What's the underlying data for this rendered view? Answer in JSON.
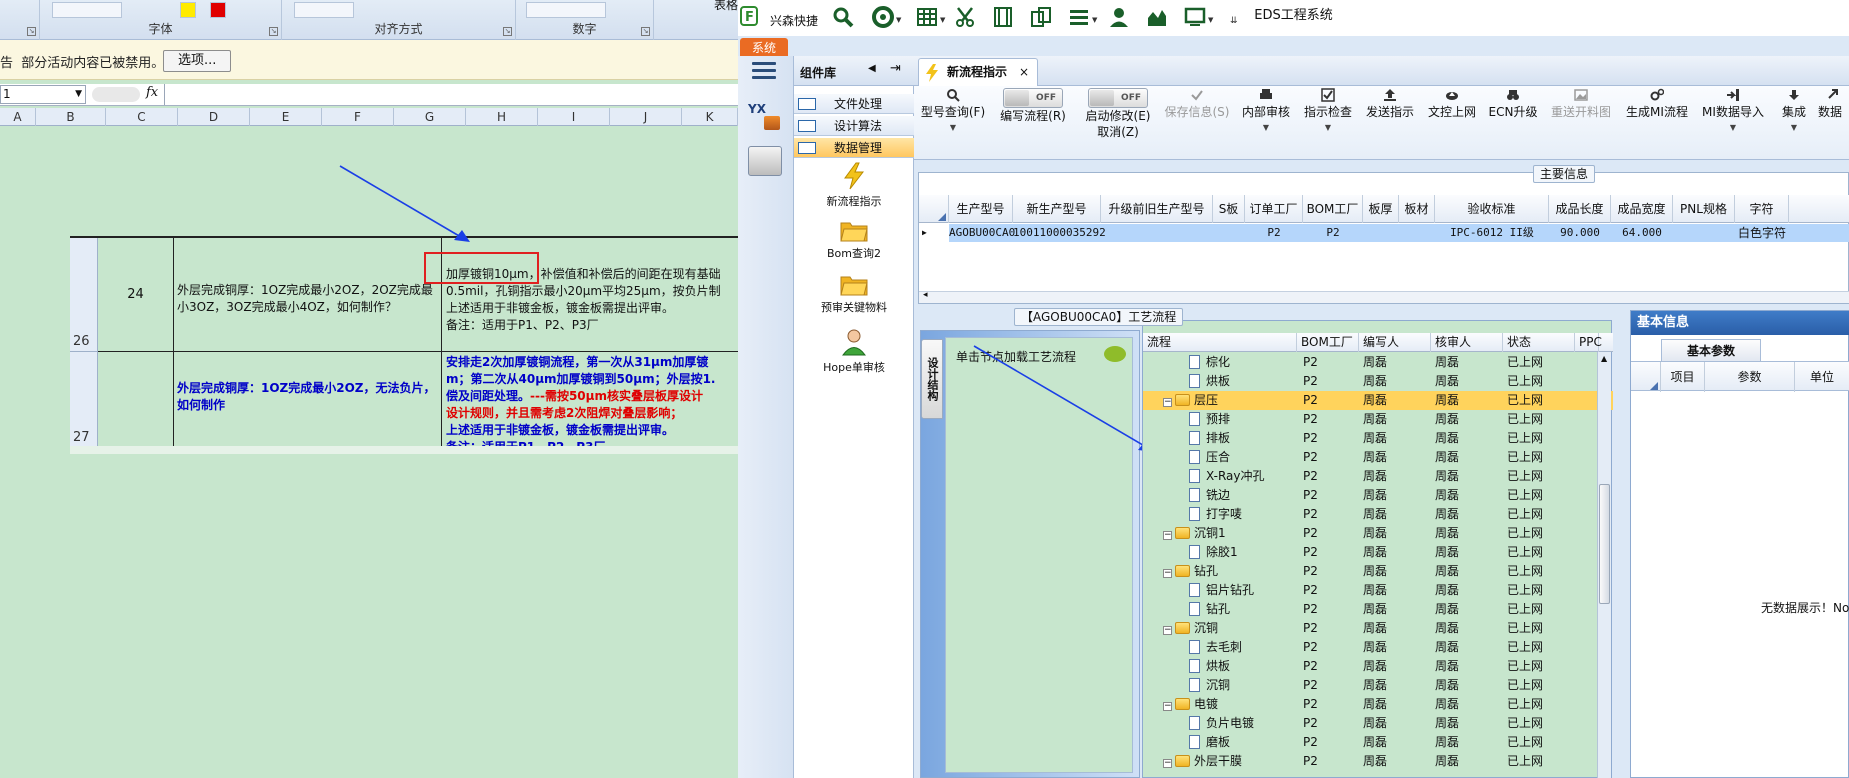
{
  "excel": {
    "ribbon_groups": [
      "字体",
      "对齐方式",
      "数字"
    ],
    "ribbon_partial": "表格",
    "security": {
      "prefix": "告",
      "message": "部分活动内容已被禁用。",
      "options_button": "选项..."
    },
    "namebox": "1",
    "fx": "fx",
    "columns": [
      "A",
      "B",
      "C",
      "D",
      "E",
      "F",
      "G",
      "H",
      "I",
      "J",
      "K"
    ],
    "rows": [
      {
        "number": "26",
        "index": "24",
        "question": "外层完成铜厚：1OZ完成最小2OZ，2OZ完成最小3OZ，3OZ完成最小4OZ，如何制作？",
        "answer": [
          "加厚镀铜10μm，补偿值和补偿后的间距在现有基础",
          "0.5mil，孔铜指示最小20μm平均25μm，按负片制",
          "上述适用于非镀金板，镀金板需提出评审。",
          "备注：适用于P1、P2、P3厂"
        ]
      },
      {
        "number": "27",
        "index": "",
        "question": "外层完成铜厚：1OZ完成最小2OZ，无法负片，如何制作",
        "answer_blue_1": "安排走2次加厚镀铜流程，第一次从31μm加厚镀",
        "answer_blue_2": "m；第二次从40μm加厚镀铜到50μm；外层按1.",
        "answer_mix_blue": "偿及间距处理。",
        "answer_mix_red": "---需按50μm核实叠层板厚设计",
        "answer_red_2": "设计规则，并且需考虑2次阻焊对叠层影响；",
        "answer_blue_3": "上述适用于非镀金板，镀金板需提出评审。",
        "answer_blue_4": "备注：适用于P1、P2、P3厂"
      }
    ]
  },
  "eds": {
    "window_title": "EDS工程系统",
    "brand": "兴森快捷",
    "system_tab": "系统",
    "library": {
      "title": "组件库",
      "categories": [
        "文件处理",
        "设计算法",
        "数据管理"
      ],
      "tools": [
        "新流程指示",
        "Bom查询2",
        "预审关键物料",
        "Hope单审核"
      ]
    },
    "doc_tab": "新流程指示",
    "doc_tab_close": "×",
    "toolbar": {
      "query": "型号查询(F)",
      "write_flow": "编写流程(R)",
      "enable_edit": "启动修改(E)",
      "cancel": "取消(Z)",
      "toggle_off": "OFF",
      "save_info": "保存信息(S)",
      "internal_review": "内部审核",
      "indicator_check": "指示检查",
      "send_indicator": "发送指示",
      "upload": "文控上网",
      "ecn_upgrade": "ECN升级",
      "resend_material": "重送开料图",
      "gen_mi_flow": "生成MI流程",
      "mi_import": "MI数据导入",
      "integrate": "集成",
      "data_partial": "数据"
    },
    "main_info": {
      "title": "主要信息",
      "columns": [
        "生产型号",
        "新生产型号",
        "升级前旧生产型号",
        "S板",
        "订单工厂",
        "BOM工厂",
        "板厚",
        "板材",
        "验收标准",
        "成品长度",
        "成品宽度",
        "PNL规格",
        "字符"
      ],
      "row": [
        "AGOBU00CA0",
        "10011000035292",
        "",
        "",
        "P2",
        "P2",
        "",
        "",
        "IPC-6012 II级",
        "90.000",
        "64.000",
        "",
        "白色字符"
      ]
    },
    "structure": {
      "tab": "设计结构",
      "hint": "单击节点加载工艺流程"
    },
    "process": {
      "title": "【AGOBU00CA0】工艺流程",
      "columns": [
        "流程",
        "BOM工厂",
        "编写人",
        "核审人",
        "状态",
        "PPC"
      ],
      "rows": [
        {
          "name": "棕化",
          "level": 2,
          "folder": false,
          "bom": "P2",
          "writer": "周磊",
          "reviewer": "周磊",
          "status": "已上网",
          "hl": false
        },
        {
          "name": "烘板",
          "level": 2,
          "folder": false,
          "bom": "P2",
          "writer": "周磊",
          "reviewer": "周磊",
          "status": "已上网",
          "hl": false
        },
        {
          "name": "层压",
          "level": 1,
          "folder": true,
          "bom": "P2",
          "writer": "周磊",
          "reviewer": "周磊",
          "status": "已上网",
          "hl": true
        },
        {
          "name": "预排",
          "level": 2,
          "folder": false,
          "bom": "P2",
          "writer": "周磊",
          "reviewer": "周磊",
          "status": "已上网",
          "hl": false
        },
        {
          "name": "排板",
          "level": 2,
          "folder": false,
          "bom": "P2",
          "writer": "周磊",
          "reviewer": "周磊",
          "status": "已上网",
          "hl": false
        },
        {
          "name": "压合",
          "level": 2,
          "folder": false,
          "bom": "P2",
          "writer": "周磊",
          "reviewer": "周磊",
          "status": "已上网",
          "hl": false
        },
        {
          "name": "X-Ray冲孔",
          "level": 2,
          "folder": false,
          "bom": "P2",
          "writer": "周磊",
          "reviewer": "周磊",
          "status": "已上网",
          "hl": false
        },
        {
          "name": "铣边",
          "level": 2,
          "folder": false,
          "bom": "P2",
          "writer": "周磊",
          "reviewer": "周磊",
          "status": "已上网",
          "hl": false
        },
        {
          "name": "打字唛",
          "level": 2,
          "folder": false,
          "bom": "P2",
          "writer": "周磊",
          "reviewer": "周磊",
          "status": "已上网",
          "hl": false
        },
        {
          "name": "沉铜1",
          "level": 1,
          "folder": true,
          "bom": "P2",
          "writer": "周磊",
          "reviewer": "周磊",
          "status": "已上网",
          "hl": false
        },
        {
          "name": "除胶1",
          "level": 2,
          "folder": false,
          "bom": "P2",
          "writer": "周磊",
          "reviewer": "周磊",
          "status": "已上网",
          "hl": false
        },
        {
          "name": "钻孔",
          "level": 1,
          "folder": true,
          "bom": "P2",
          "writer": "周磊",
          "reviewer": "周磊",
          "status": "已上网",
          "hl": false
        },
        {
          "name": "铝片钻孔",
          "level": 2,
          "folder": false,
          "bom": "P2",
          "writer": "周磊",
          "reviewer": "周磊",
          "status": "已上网",
          "hl": false
        },
        {
          "name": "钻孔",
          "level": 2,
          "folder": false,
          "bom": "P2",
          "writer": "周磊",
          "reviewer": "周磊",
          "status": "已上网",
          "hl": false
        },
        {
          "name": "沉铜",
          "level": 1,
          "folder": true,
          "bom": "P2",
          "writer": "周磊",
          "reviewer": "周磊",
          "status": "已上网",
          "hl": false
        },
        {
          "name": "去毛刺",
          "level": 2,
          "folder": false,
          "bom": "P2",
          "writer": "周磊",
          "reviewer": "周磊",
          "status": "已上网",
          "hl": false
        },
        {
          "name": "烘板",
          "level": 2,
          "folder": false,
          "bom": "P2",
          "writer": "周磊",
          "reviewer": "周磊",
          "status": "已上网",
          "hl": false
        },
        {
          "name": "沉铜",
          "level": 2,
          "folder": false,
          "bom": "P2",
          "writer": "周磊",
          "reviewer": "周磊",
          "status": "已上网",
          "hl": false
        },
        {
          "name": "电镀",
          "level": 1,
          "folder": true,
          "bom": "P2",
          "writer": "周磊",
          "reviewer": "周磊",
          "status": "已上网",
          "hl": false
        },
        {
          "name": "负片电镀",
          "level": 2,
          "folder": false,
          "bom": "P2",
          "writer": "周磊",
          "reviewer": "周磊",
          "status": "已上网",
          "hl": false
        },
        {
          "name": "磨板",
          "level": 2,
          "folder": false,
          "bom": "P2",
          "writer": "周磊",
          "reviewer": "周磊",
          "status": "已上网",
          "hl": false
        },
        {
          "name": "外层干膜",
          "level": 1,
          "folder": true,
          "bom": "P2",
          "writer": "周磊",
          "reviewer": "周磊",
          "status": "已上网",
          "hl": false
        }
      ]
    },
    "basic": {
      "title": "基本信息",
      "tab": "基本参数",
      "columns": [
        "项目",
        "参数",
        "单位"
      ],
      "empty": "无数据展示！No"
    },
    "colors": {
      "accent": "#2a5ea8",
      "system_tab": "#ea6b23",
      "highlight": "#ffd35c",
      "arrow": "#1a3fe6",
      "red_box": "#e02020"
    }
  }
}
